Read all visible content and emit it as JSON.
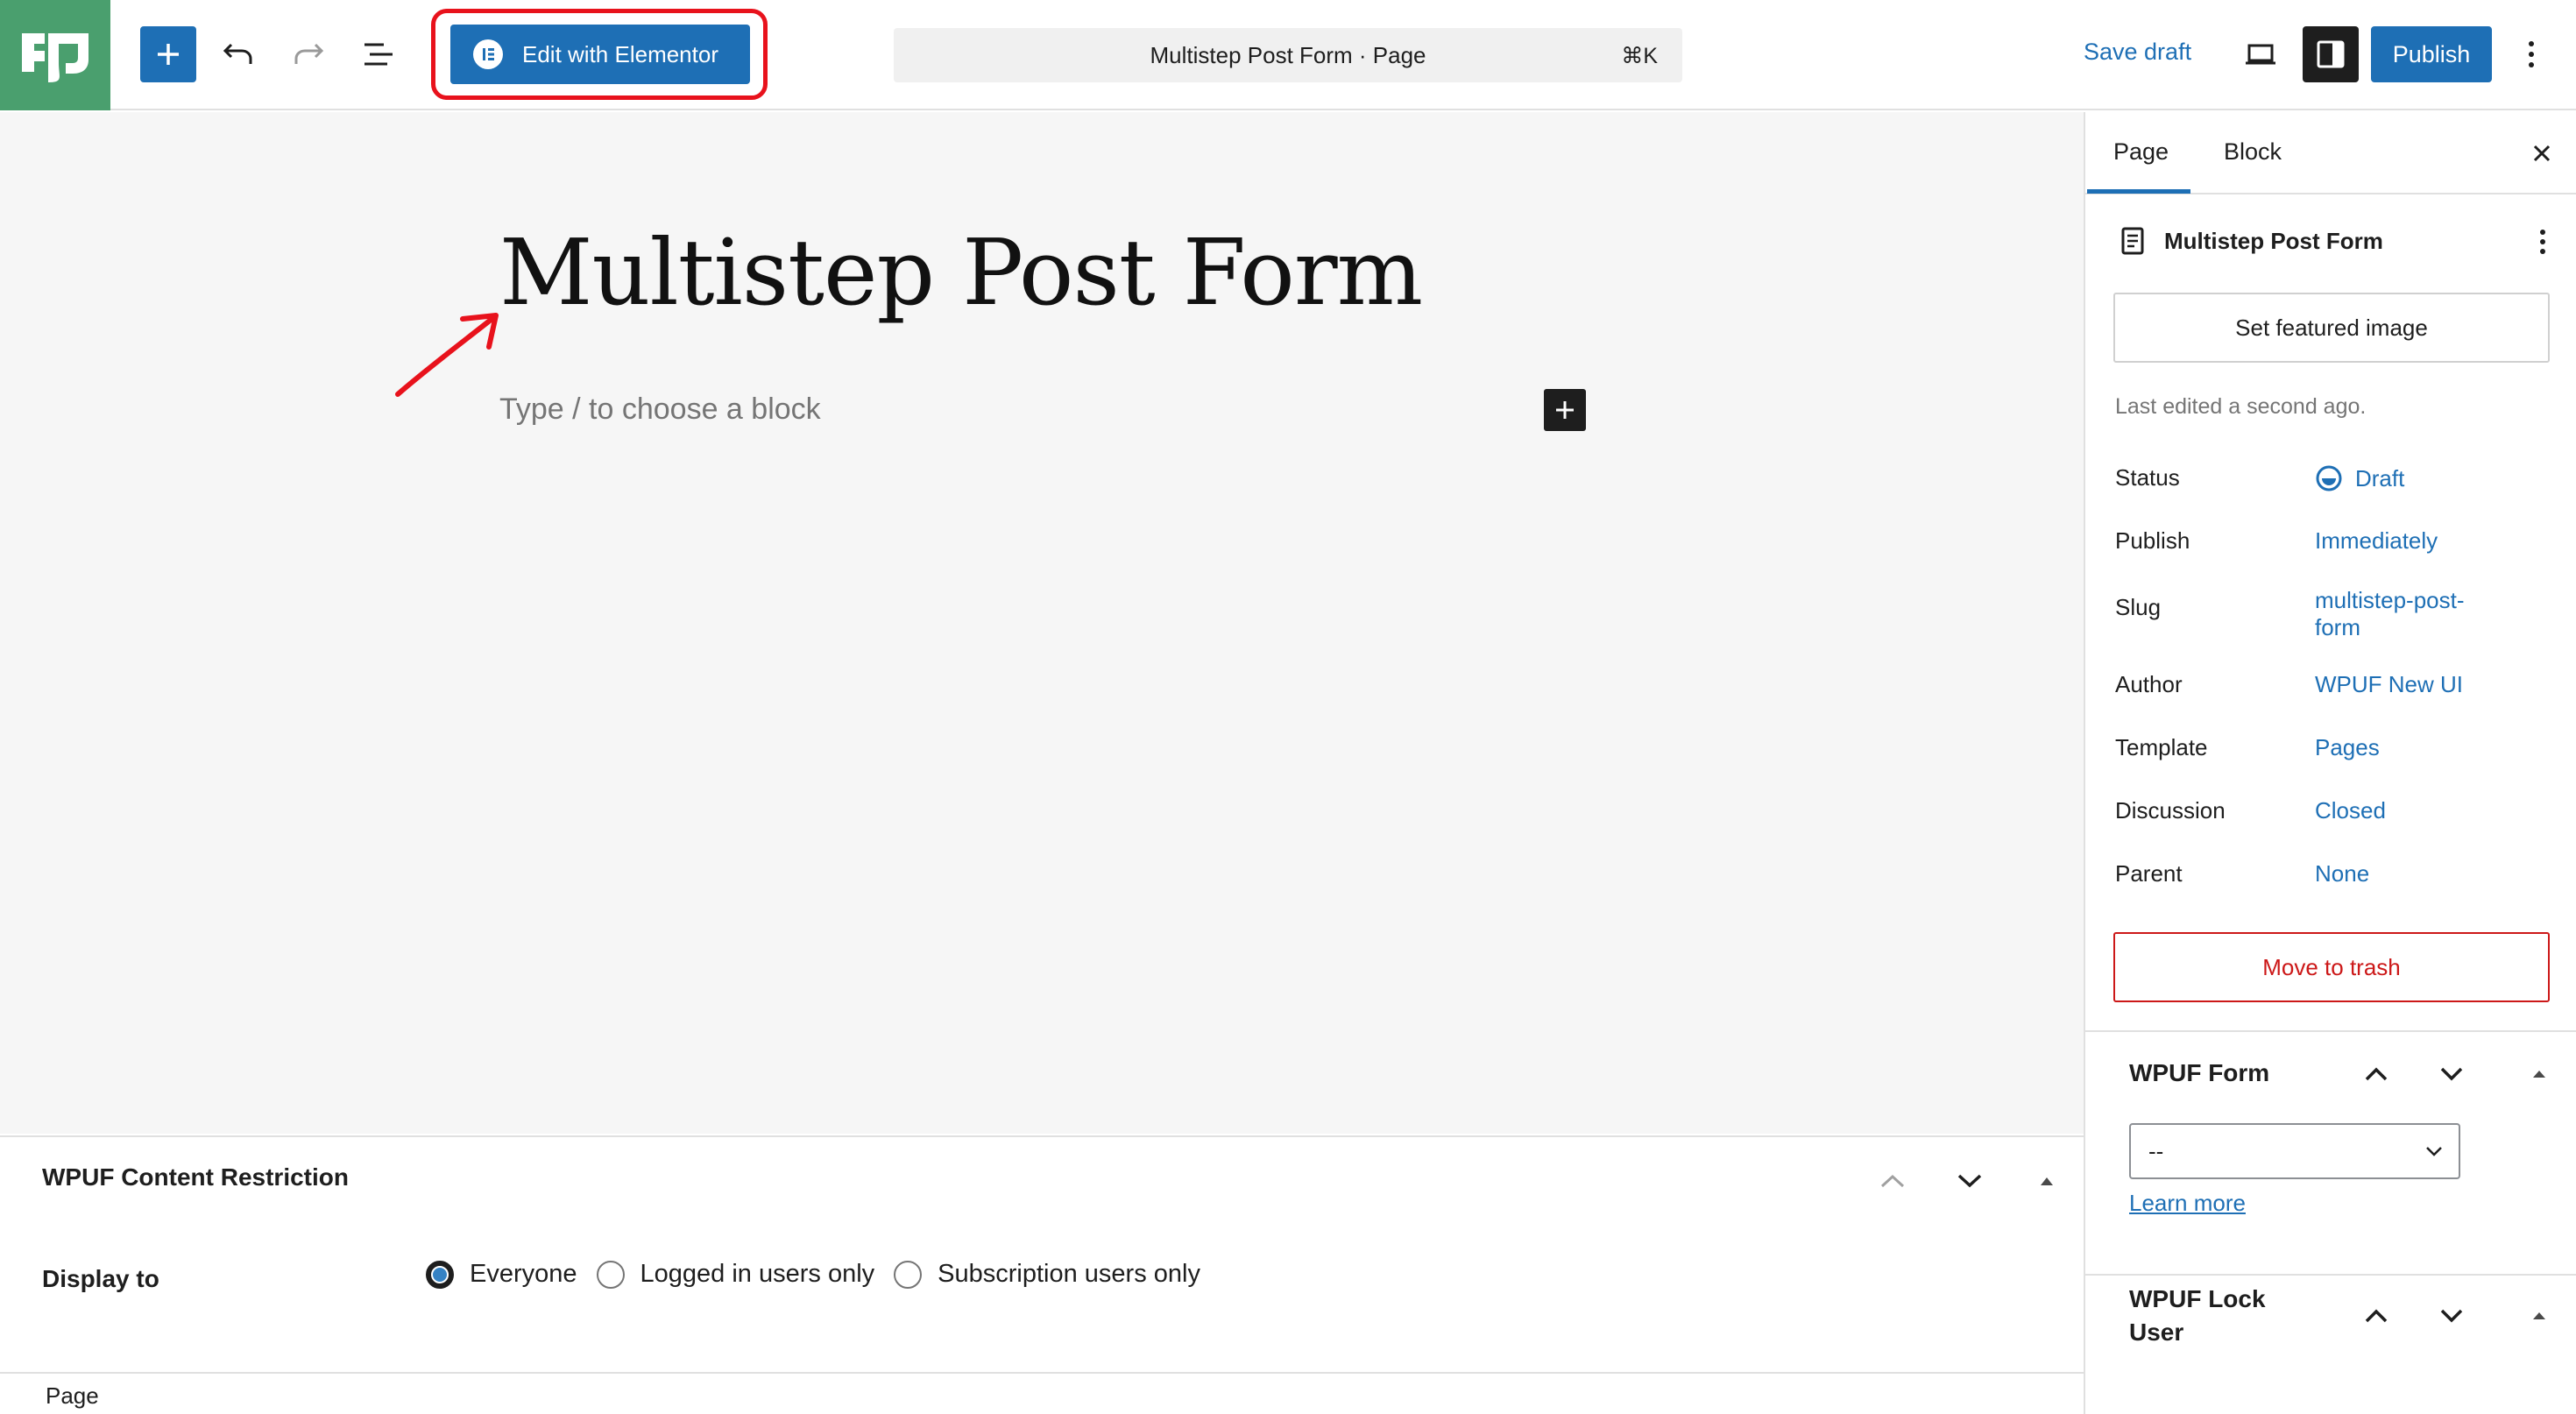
{
  "toolbar": {
    "elementor_label": "Edit with Elementor",
    "command_title": "Multistep Post Form · Page",
    "command_shortcut": "⌘K",
    "save_draft": "Save draft",
    "publish": "Publish"
  },
  "editor": {
    "title": "Multistep Post Form",
    "block_placeholder": "Type / to choose a block"
  },
  "content_restriction": {
    "title": "WPUF Content Restriction",
    "display_label": "Display to",
    "options": [
      "Everyone",
      "Logged in users only",
      "Subscription users only"
    ],
    "selected": "Everyone"
  },
  "footer": {
    "breadcrumb": "Page"
  },
  "sidebar": {
    "tabs": [
      "Page",
      "Block"
    ],
    "active_tab": "Page",
    "doc_title": "Multistep Post Form",
    "featured_image_button": "Set featured image",
    "last_edited": "Last edited a second ago.",
    "meta": [
      {
        "key": "Status",
        "value": "Draft"
      },
      {
        "key": "Publish",
        "value": "Immediately"
      },
      {
        "key": "Slug",
        "value": "multistep-post-form"
      },
      {
        "key": "Author",
        "value": "WPUF New UI"
      },
      {
        "key": "Template",
        "value": "Pages"
      },
      {
        "key": "Discussion",
        "value": "Closed"
      },
      {
        "key": "Parent",
        "value": "None"
      }
    ],
    "trash_button": "Move to trash",
    "wpuf_form": {
      "title": "WPUF Form",
      "select_value": "--",
      "learn_more": "Learn more"
    },
    "wpuf_lock_user": {
      "title": "WPUF Lock User"
    }
  },
  "colors": {
    "accent": "#1e6fb5",
    "logo_bg": "#4a9f6e",
    "highlight": "#e8121c",
    "danger": "#cc1818"
  }
}
